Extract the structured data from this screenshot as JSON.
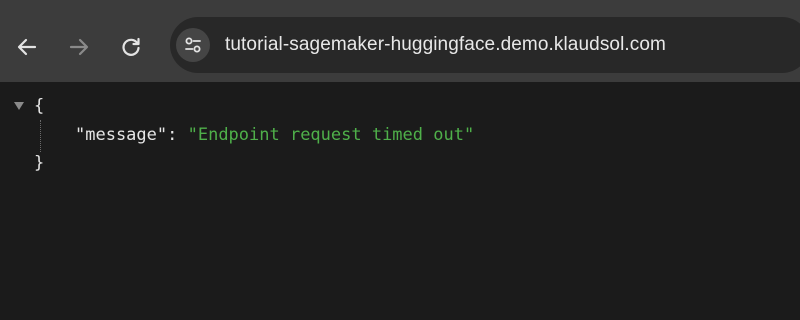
{
  "browser": {
    "url": "tutorial-sagemaker-huggingface.demo.klaudsol.com",
    "icons": {
      "back": "arrow-left-icon",
      "forward": "arrow-right-icon",
      "reload": "reload-icon",
      "site_info": "tune-icon"
    }
  },
  "json_view": {
    "open_brace": "{",
    "close_brace": "}",
    "key": "\"message\"",
    "colon": ": ",
    "value": "\"Endpoint request timed out\""
  },
  "colors": {
    "toolbar_bg": "#3c3c3c",
    "omnibox_bg": "#282828",
    "page_bg": "#1b1b1b",
    "string_value": "#4fb04a",
    "text": "#e6e6e6"
  }
}
